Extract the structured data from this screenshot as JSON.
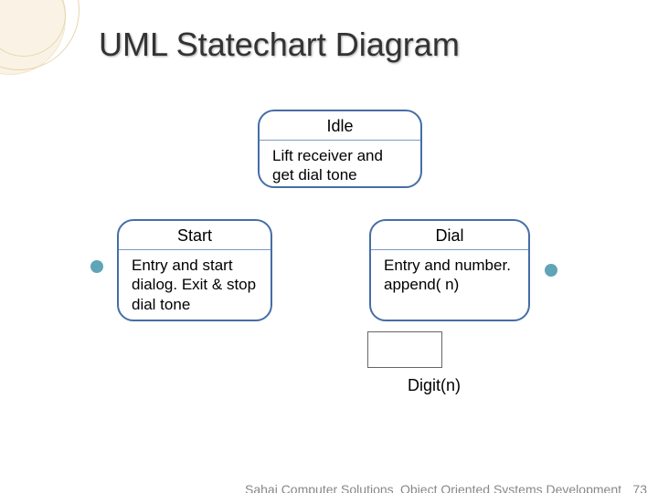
{
  "title": "UML Statechart Diagram",
  "states": {
    "idle": {
      "name": "Idle",
      "body": "Lift receiver and get dial tone"
    },
    "start": {
      "name": "Start",
      "body": "Entry and start dialog. Exit & stop dial tone"
    },
    "dial": {
      "name": "Dial",
      "body": "Entry and number. append( n)"
    }
  },
  "transition_label": "Digit(n)",
  "footer": {
    "left": "Sahaj Computer Solutions",
    "right": "Object Oriented Systems Development",
    "page": "73"
  }
}
